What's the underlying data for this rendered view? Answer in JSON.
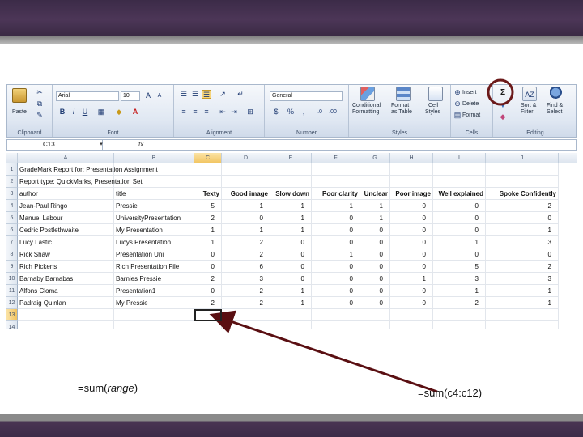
{
  "ribbon": {
    "clipboard": {
      "label": "Clipboard",
      "paste": "Paste"
    },
    "font": {
      "label": "Font",
      "font_name": "Arial",
      "font_size": "10",
      "bold": "B",
      "italic": "I",
      "underline": "U"
    },
    "alignment": {
      "label": "Alignment"
    },
    "number": {
      "label": "Number",
      "format": "General",
      "currency": "$",
      "percent": "%",
      "comma": ","
    },
    "styles": {
      "label": "Styles",
      "conditional": [
        "Conditional",
        "Formatting"
      ],
      "format_table": [
        "Format",
        "as Table"
      ],
      "cell_styles": [
        "Cell",
        "Styles"
      ]
    },
    "cells": {
      "label": "Cells",
      "insert": "Insert",
      "delete": "Delete",
      "format": "Format"
    },
    "editing": {
      "label": "Editing",
      "sigma": "Σ",
      "sort": [
        "Sort &",
        "Filter"
      ],
      "find": [
        "Find &",
        "Select"
      ]
    },
    "highlight_color": "#6b1a1a"
  },
  "formula_bar": {
    "name_box": "C13",
    "fx": "fx",
    "formula": ""
  },
  "sheet": {
    "columns": [
      "A",
      "B",
      "C",
      "D",
      "E",
      "F",
      "G",
      "H",
      "I",
      "J"
    ],
    "rows": [
      {
        "n": "1",
        "cells": [
          "GradeMark Report for: Presentation Assignment",
          "",
          "",
          "",
          "",
          "",
          "",
          "",
          "",
          ""
        ]
      },
      {
        "n": "2",
        "cells": [
          "Report type: QuickMarks, Presentation Set",
          "",
          "",
          "",
          "",
          "",
          "",
          "",
          "",
          ""
        ]
      },
      {
        "n": "3",
        "cells": [
          "author",
          "title",
          "Texty",
          "Good image",
          "Slow down",
          "Poor clarity",
          "Unclear",
          "Poor image",
          "Well explained",
          "Spoke Confidently"
        ]
      },
      {
        "n": "4",
        "cells": [
          "Jean-Paul Ringo",
          "Pressie",
          "5",
          "1",
          "1",
          "1",
          "1",
          "0",
          "0",
          "2"
        ]
      },
      {
        "n": "5",
        "cells": [
          "Manuel Labour",
          "UniversityPresentation",
          "2",
          "0",
          "1",
          "0",
          "1",
          "0",
          "0",
          "0"
        ]
      },
      {
        "n": "6",
        "cells": [
          "Cedric Postlethwaite",
          "My Presentation",
          "1",
          "1",
          "1",
          "0",
          "0",
          "0",
          "0",
          "1"
        ]
      },
      {
        "n": "7",
        "cells": [
          "Lucy Lastic",
          "Lucys Presentation",
          "1",
          "2",
          "0",
          "0",
          "0",
          "0",
          "1",
          "3"
        ]
      },
      {
        "n": "8",
        "cells": [
          "Rick Shaw",
          "Presentation Uni",
          "0",
          "2",
          "0",
          "1",
          "0",
          "0",
          "0",
          "0"
        ]
      },
      {
        "n": "9",
        "cells": [
          "Rich Pickens",
          "Rich Presentation File",
          "0",
          "6",
          "0",
          "0",
          "0",
          "0",
          "5",
          "2"
        ]
      },
      {
        "n": "10",
        "cells": [
          "Barnaby Barnabas",
          "Barnies Pressie",
          "2",
          "3",
          "0",
          "0",
          "0",
          "1",
          "3",
          "3"
        ]
      },
      {
        "n": "11",
        "cells": [
          "Alfons Cloma",
          "Presentation1",
          "0",
          "2",
          "1",
          "0",
          "0",
          "0",
          "1",
          "1"
        ]
      },
      {
        "n": "12",
        "cells": [
          "Padraig Quinlan",
          "My Pressie",
          "2",
          "2",
          "1",
          "0",
          "0",
          "0",
          "2",
          "1"
        ]
      },
      {
        "n": "13",
        "cells": [
          "",
          "",
          "",
          "",
          "",
          "",
          "",
          "",
          "",
          ""
        ]
      },
      {
        "n": "14",
        "cells": [
          "",
          "",
          "",
          "",
          "",
          "",
          "",
          "",
          "",
          ""
        ]
      }
    ],
    "selected_cell": "C13"
  },
  "annotations": {
    "left_caption_prefix": "=sum(",
    "left_caption_arg": "range",
    "left_caption_suffix": ")",
    "right_caption": "=sum(c4:c12)",
    "arrow_color": "#5a0f12"
  }
}
